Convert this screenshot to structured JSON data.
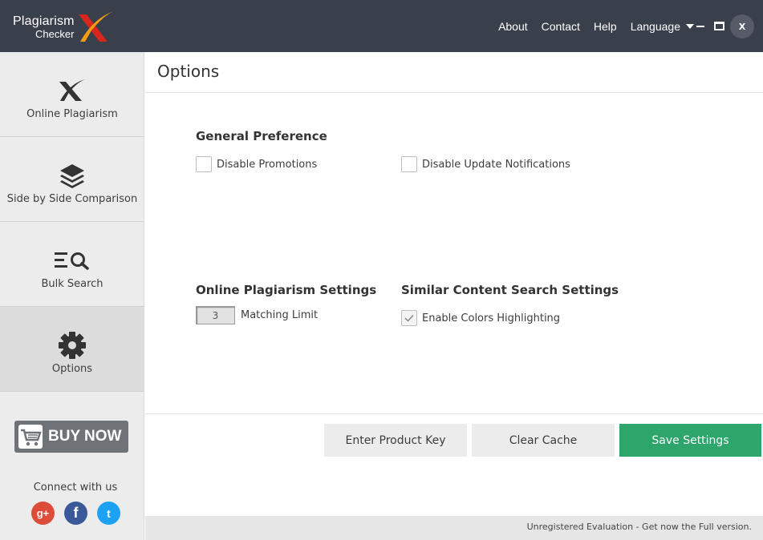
{
  "app": {
    "logo_line1": "Plagiarism",
    "logo_line2": "Checker"
  },
  "topnav": {
    "about": "About",
    "contact": "Contact",
    "help": "Help",
    "language": "Language"
  },
  "window_controls": {
    "close_glyph": "x"
  },
  "sidebar": {
    "items": [
      {
        "label": "Online Plagiarism",
        "icon": "x-logo-icon"
      },
      {
        "label": "Side by Side Comparison",
        "icon": "layers-icon"
      },
      {
        "label": "Bulk Search",
        "icon": "list-search-icon"
      },
      {
        "label": "Options",
        "icon": "gear-icon",
        "active": true
      }
    ],
    "buy_now": "BUY NOW",
    "connect": "Connect with us",
    "social": {
      "google": "g+",
      "facebook": "f",
      "twitter": "t"
    }
  },
  "main": {
    "title": "Options",
    "general": {
      "title": "General Preference",
      "disable_promotions": "Disable Promotions",
      "disable_promotions_checked": false,
      "disable_updates": "Disable Update Notifications",
      "disable_updates_checked": false
    },
    "online": {
      "title": "Online Plagiarism Settings",
      "matching_limit_value": "3",
      "matching_limit_label": "Matching Limit"
    },
    "similar": {
      "title": "Similar Content Search Settings",
      "enable_colors": "Enable Colors Highlighting",
      "enable_colors_checked": true
    },
    "buttons": {
      "product_key": "Enter Product Key",
      "clear_cache": "Clear Cache",
      "save": "Save Settings"
    }
  },
  "status": {
    "text": "Unregistered Evaluation - Get now the Full version."
  },
  "colors": {
    "titlebar": "#3a3f4c",
    "accent_green": "#2ea56b",
    "logo_red": "#d7261e",
    "logo_orange": "#f39c12"
  }
}
